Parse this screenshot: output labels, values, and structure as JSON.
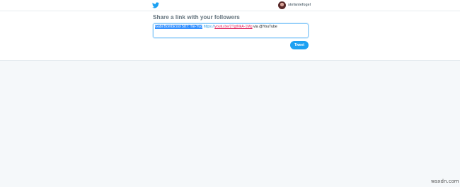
{
  "header": {
    "logo_icon": "twitter-bird-icon",
    "username": "stefaniefogel",
    "brand_color": "#1da1f2"
  },
  "share": {
    "heading": "Share a link with your followers",
    "compose": {
      "selected_text": "Gabi Bombicool 587: Tie-Yud",
      "link_prefix": "https://",
      "link_rest": "youtu.be/2TgtNkA-1Mg",
      "suffix": " via @YouTube"
    },
    "tweet_button_label": "Tweet"
  },
  "watermark": "wsxdn.com"
}
